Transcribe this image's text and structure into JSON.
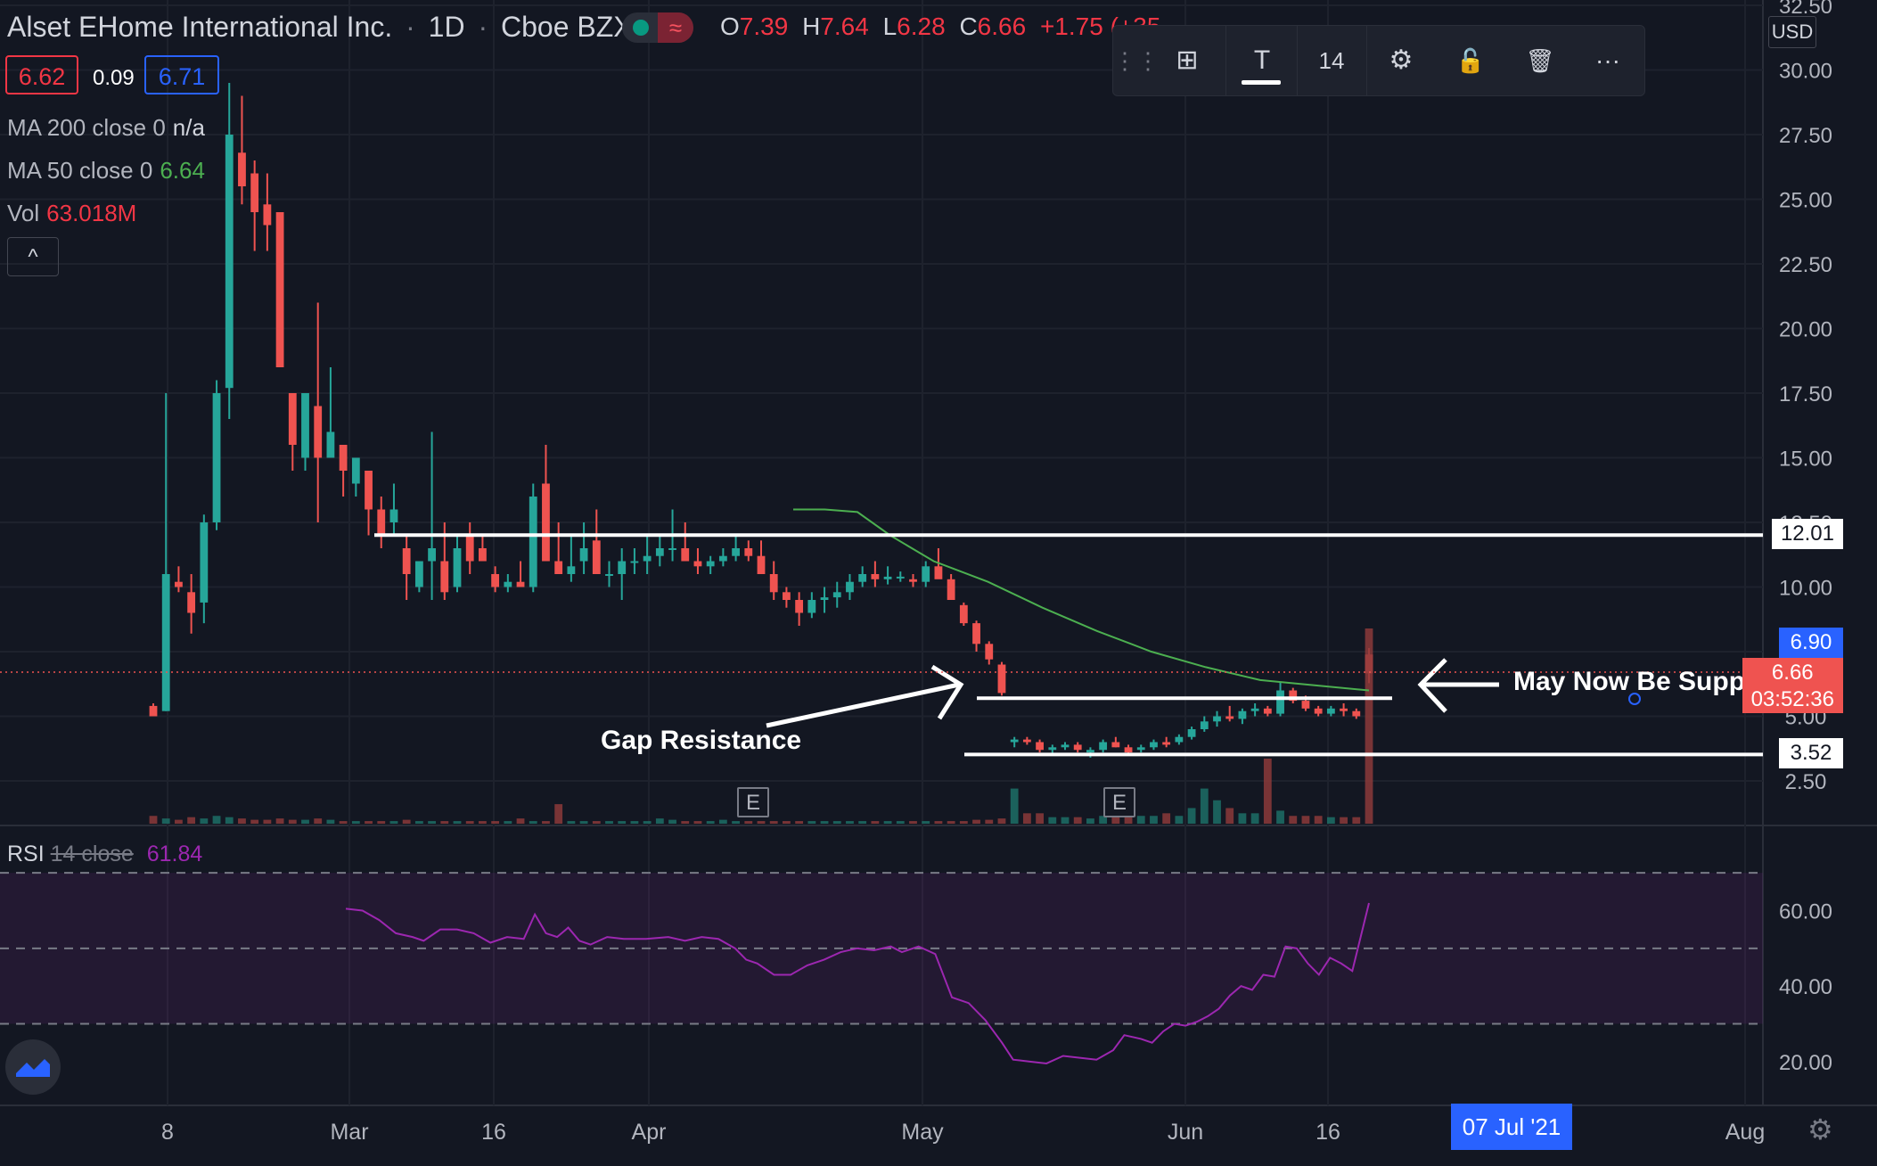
{
  "header": {
    "symbol_name": "Alset EHome International Inc.",
    "interval": "1D",
    "exchange": "Cboe BZX",
    "ohlc": [
      {
        "key": "O",
        "value": "7.39"
      },
      {
        "key": "H",
        "value": "7.64"
      },
      {
        "key": "L",
        "value": "6.28"
      },
      {
        "key": "C",
        "value": "6.66"
      }
    ],
    "change": "+1.75 (+35",
    "bid": "6.62",
    "spread": "0.09",
    "ask": "6.71",
    "toggle_icon": "≈"
  },
  "indicators": [
    {
      "name": "MA 200 close 0",
      "value": "n/a",
      "color": "#d1d4dc"
    },
    {
      "name": "MA 50 close 0",
      "value": "6.64",
      "color": "#4caf50"
    },
    {
      "name": "Vol",
      "value": "63.018M",
      "color": "#f23645"
    }
  ],
  "collapse_icon": "^",
  "toolbar": {
    "items": [
      {
        "icon": "drag-handle-icon",
        "label": "⋮⋮"
      },
      {
        "icon": "object-tree-icon",
        "label": "⊞"
      },
      {
        "icon": "text-icon",
        "label": "T"
      },
      {
        "icon": "font-size",
        "label": "14"
      },
      {
        "icon": "settings-icon",
        "label": "⚙"
      },
      {
        "icon": "lock-icon",
        "label": "🔓"
      },
      {
        "icon": "trash-icon",
        "label": "🗑"
      },
      {
        "icon": "more-icon",
        "label": "···"
      }
    ]
  },
  "annotations": {
    "gap_resistance": "Gap Resistance",
    "may_now_be_support": "May Now Be Support"
  },
  "price_labels": {
    "currency": "USD",
    "level_high": "12.01",
    "level_low": "3.52",
    "bid_price": "6.90",
    "last_price": "6.66",
    "countdown": "03:52:36"
  },
  "earnings_marker": "E",
  "rsi": {
    "name": "RSI",
    "params": "14 close",
    "value": "61.84"
  },
  "date_flag": "07 Jul '21",
  "colors": {
    "up": "#26a69a",
    "down": "#ef5350",
    "ma50": "#4caf50",
    "rsi": "#9c27b0",
    "accent": "#2962ff"
  },
  "chart_data": {
    "type": "candlestick",
    "price_axis": {
      "ticks": [
        "2.50",
        "5.00",
        "7.50",
        "10.00",
        "12.50",
        "15.00",
        "17.50",
        "20.00",
        "22.50",
        "25.00",
        "27.50",
        "30.00",
        "32.50"
      ],
      "ylim": [
        1.6,
        33.0
      ]
    },
    "x_ticks": [
      "8",
      "Mar",
      "16",
      "Apr",
      "May",
      "Jun",
      "16",
      "Aug"
    ],
    "horizontal_levels": [
      12.01,
      5.7,
      3.52
    ],
    "candles": [
      [
        5.4,
        5.5,
        5.1,
        5.0
      ],
      [
        5.2,
        17.5,
        5.2,
        10.5
      ],
      [
        10.2,
        10.8,
        9.8,
        10.0
      ],
      [
        9.8,
        10.5,
        8.2,
        9.0
      ],
      [
        9.4,
        12.8,
        8.6,
        12.5
      ],
      [
        12.5,
        18.0,
        12.2,
        17.5
      ],
      [
        17.7,
        29.5,
        16.5,
        27.5
      ],
      [
        26.8,
        29.0,
        24.8,
        25.5
      ],
      [
        26.0,
        26.5,
        23.0,
        24.5
      ],
      [
        24.8,
        26.0,
        23.0,
        24.0
      ],
      [
        24.5,
        23.5,
        21.0,
        18.5
      ],
      [
        17.5,
        16.5,
        14.5,
        15.5
      ],
      [
        15.0,
        17.5,
        14.5,
        17.5
      ],
      [
        17.0,
        21.0,
        12.5,
        15.0
      ],
      [
        15.0,
        18.5,
        15.0,
        16.0
      ],
      [
        15.5,
        15.5,
        13.5,
        14.5
      ],
      [
        14.0,
        15.0,
        13.5,
        15.0
      ],
      [
        14.5,
        14.5,
        12.0,
        13.0
      ],
      [
        13.0,
        13.5,
        11.5,
        12.0
      ],
      [
        12.5,
        14.0,
        12.0,
        13.0
      ],
      [
        11.5,
        12.0,
        9.5,
        10.5
      ],
      [
        10.0,
        11.0,
        9.8,
        11.0
      ],
      [
        11.0,
        16.0,
        9.5,
        11.5
      ],
      [
        11.0,
        12.5,
        9.5,
        9.8
      ],
      [
        10.0,
        12.0,
        9.8,
        11.5
      ],
      [
        12.0,
        12.5,
        10.5,
        11.0
      ],
      [
        11.5,
        12.0,
        11.0,
        11.0
      ],
      [
        10.5,
        10.8,
        9.8,
        10.0
      ],
      [
        10.0,
        10.5,
        9.8,
        10.2
      ],
      [
        10.2,
        11.0,
        10.0,
        10.0
      ],
      [
        10.0,
        14.0,
        9.8,
        13.5
      ],
      [
        14.0,
        15.5,
        12.0,
        11.0
      ],
      [
        11.0,
        12.5,
        10.5,
        10.5
      ],
      [
        10.5,
        12.0,
        10.2,
        10.8
      ],
      [
        11.0,
        12.5,
        10.5,
        11.5
      ],
      [
        11.8,
        13.0,
        10.5,
        10.5
      ],
      [
        10.5,
        11.0,
        10.0,
        10.5
      ],
      [
        10.5,
        11.5,
        9.5,
        11.0
      ],
      [
        11.0,
        11.5,
        10.5,
        11.0
      ],
      [
        11.0,
        12.0,
        10.5,
        11.2
      ],
      [
        11.2,
        12.0,
        10.8,
        11.5
      ],
      [
        11.5,
        13.0,
        11.0,
        11.5
      ],
      [
        11.5,
        12.5,
        11.0,
        11.0
      ],
      [
        11.0,
        11.5,
        10.5,
        10.8
      ],
      [
        10.8,
        11.2,
        10.5,
        11.0
      ],
      [
        11.0,
        11.5,
        10.8,
        11.2
      ],
      [
        11.2,
        12.0,
        11.0,
        11.5
      ],
      [
        11.5,
        11.8,
        11.0,
        11.2
      ],
      [
        11.2,
        11.8,
        10.5,
        10.5
      ],
      [
        10.5,
        11.0,
        9.5,
        9.8
      ],
      [
        9.8,
        10.0,
        9.2,
        9.5
      ],
      [
        9.5,
        9.8,
        8.5,
        9.0
      ],
      [
        9.0,
        9.8,
        8.8,
        9.5
      ],
      [
        9.5,
        10.0,
        9.0,
        9.6
      ],
      [
        9.6,
        10.2,
        9.2,
        9.8
      ],
      [
        9.8,
        10.5,
        9.5,
        10.2
      ],
      [
        10.2,
        10.8,
        10.0,
        10.5
      ],
      [
        10.5,
        11.0,
        10.0,
        10.3
      ],
      [
        10.3,
        10.8,
        10.1,
        10.4
      ],
      [
        10.4,
        10.6,
        10.2,
        10.4
      ],
      [
        10.3,
        10.5,
        10.0,
        10.2
      ],
      [
        10.2,
        11.0,
        10.0,
        10.8
      ],
      [
        10.8,
        11.5,
        10.5,
        10.3
      ],
      [
        10.3,
        10.5,
        9.5,
        9.5
      ],
      [
        9.3,
        9.4,
        8.5,
        8.6
      ],
      [
        8.6,
        8.7,
        7.5,
        7.8
      ],
      [
        7.8,
        7.9,
        7.0,
        7.2
      ],
      [
        7.0,
        7.1,
        5.8,
        5.9
      ],
      [
        4.0,
        4.2,
        3.8,
        4.1
      ],
      [
        4.1,
        4.2,
        3.9,
        4.0
      ],
      [
        4.0,
        4.1,
        3.6,
        3.7
      ],
      [
        3.7,
        3.9,
        3.5,
        3.8
      ],
      [
        3.8,
        4.0,
        3.7,
        3.9
      ],
      [
        3.9,
        4.0,
        3.6,
        3.7
      ],
      [
        3.6,
        3.8,
        3.4,
        3.7
      ],
      [
        3.7,
        4.1,
        3.6,
        4.0
      ],
      [
        4.0,
        4.2,
        3.8,
        3.8
      ],
      [
        3.8,
        3.9,
        3.5,
        3.6
      ],
      [
        3.7,
        3.9,
        3.6,
        3.8
      ],
      [
        3.8,
        4.1,
        3.7,
        4.0
      ],
      [
        4.0,
        4.2,
        3.8,
        3.9
      ],
      [
        4.0,
        4.3,
        3.9,
        4.2
      ],
      [
        4.2,
        4.6,
        4.1,
        4.5
      ],
      [
        4.5,
        5.0,
        4.4,
        4.8
      ],
      [
        4.8,
        5.2,
        4.6,
        5.0
      ],
      [
        5.0,
        5.4,
        4.8,
        4.9
      ],
      [
        4.9,
        5.3,
        4.7,
        5.2
      ],
      [
        5.2,
        5.5,
        5.0,
        5.3
      ],
      [
        5.3,
        5.4,
        5.0,
        5.1
      ],
      [
        5.1,
        6.3,
        5.0,
        6.0
      ],
      [
        6.0,
        6.1,
        5.5,
        5.6
      ],
      [
        5.6,
        5.8,
        5.2,
        5.3
      ],
      [
        5.3,
        5.4,
        5.0,
        5.1
      ],
      [
        5.1,
        5.4,
        5.0,
        5.3
      ],
      [
        5.3,
        5.5,
        5.0,
        5.2
      ],
      [
        5.2,
        5.3,
        4.9,
        5.0
      ],
      [
        7.39,
        7.64,
        6.28,
        6.66
      ]
    ],
    "volume": [
      0.6,
      0.4,
      0.3,
      0.5,
      0.4,
      0.6,
      0.5,
      0.4,
      0.3,
      0.3,
      0.4,
      0.3,
      0.3,
      0.4,
      0.3,
      0.2,
      0.2,
      0.2,
      0.2,
      0.2,
      0.3,
      0.2,
      0.2,
      0.2,
      0.2,
      0.2,
      0.2,
      0.2,
      0.2,
      0.4,
      0.2,
      0.2,
      1.5,
      0.2,
      0.2,
      0.2,
      0.2,
      0.2,
      0.2,
      0.2,
      0.4,
      0.3,
      0.2,
      0.2,
      0.2,
      0.3,
      0.2,
      0.2,
      0.2,
      0.2,
      0.2,
      0.2,
      0.2,
      0.2,
      0.2,
      0.2,
      0.2,
      0.2,
      0.2,
      0.2,
      0.2,
      0.2,
      0.2,
      0.2,
      0.2,
      0.3,
      0.3,
      0.4,
      2.7,
      0.8,
      0.8,
      0.5,
      0.5,
      0.5,
      0.4,
      0.6,
      1.0,
      0.6,
      0.6,
      0.6,
      0.8,
      0.6,
      1.2,
      2.7,
      1.8,
      1.2,
      0.8,
      0.8,
      5.0,
      1.0,
      0.6,
      0.6,
      0.6,
      0.5,
      0.5,
      0.5,
      15.0
    ],
    "ma50": [
      [
        0.471,
        13.0
      ],
      [
        0.5,
        13.0
      ],
      [
        0.53,
        12.9
      ],
      [
        0.56,
        12.0
      ],
      [
        0.6,
        11.0
      ],
      [
        0.65,
        10.2
      ],
      [
        0.7,
        9.2
      ],
      [
        0.75,
        8.3
      ],
      [
        0.8,
        7.5
      ],
      [
        0.85,
        6.9
      ],
      [
        0.9,
        6.4
      ],
      [
        0.95,
        6.2
      ],
      [
        1.0,
        6.0
      ]
    ],
    "rsi": {
      "ylim": [
        15,
        75
      ],
      "ticks": [
        "20.00",
        "40.00",
        "60.00"
      ],
      "bands": [
        30,
        50,
        70
      ],
      "values": [
        [
          0.2,
          60.5
        ],
        [
          0.215,
          60.0
        ],
        [
          0.23,
          57.5
        ],
        [
          0.245,
          54.0
        ],
        [
          0.26,
          53.0
        ],
        [
          0.27,
          52.0
        ],
        [
          0.285,
          55.0
        ],
        [
          0.3,
          55.0
        ],
        [
          0.315,
          54.0
        ],
        [
          0.33,
          51.5
        ],
        [
          0.345,
          53.0
        ],
        [
          0.36,
          52.5
        ],
        [
          0.37,
          59.0
        ],
        [
          0.38,
          54.0
        ],
        [
          0.39,
          53.0
        ],
        [
          0.4,
          55.5
        ],
        [
          0.41,
          52.0
        ],
        [
          0.42,
          51.0
        ],
        [
          0.435,
          53.0
        ],
        [
          0.45,
          52.5
        ],
        [
          0.47,
          52.5
        ],
        [
          0.49,
          53.0
        ],
        [
          0.505,
          52.0
        ],
        [
          0.52,
          53.0
        ],
        [
          0.535,
          52.5
        ],
        [
          0.55,
          50.0
        ],
        [
          0.56,
          47.0
        ],
        [
          0.57,
          46.0
        ],
        [
          0.585,
          43.0
        ],
        [
          0.6,
          43.0
        ],
        [
          0.615,
          45.5
        ],
        [
          0.63,
          47.0
        ],
        [
          0.645,
          49.0
        ],
        [
          0.66,
          50.0
        ],
        [
          0.675,
          49.5
        ],
        [
          0.69,
          50.5
        ],
        [
          0.7,
          49.0
        ],
        [
          0.715,
          50.5
        ],
        [
          0.73,
          48.5
        ],
        [
          0.745,
          37.0
        ],
        [
          0.76,
          35.5
        ],
        [
          0.775,
          31.0
        ],
        [
          0.79,
          25.0
        ],
        [
          0.8,
          20.5
        ],
        [
          0.815,
          20.0
        ],
        [
          0.83,
          19.5
        ],
        [
          0.845,
          21.5
        ],
        [
          0.86,
          21.0
        ],
        [
          0.875,
          20.5
        ],
        [
          0.89,
          23.0
        ],
        [
          0.9,
          27.0
        ],
        [
          0.915,
          26.0
        ],
        [
          0.925,
          25.0
        ],
        [
          0.935,
          28.0
        ],
        [
          0.945,
          30.0
        ],
        [
          0.955,
          29.5
        ],
        [
          0.965,
          30.5
        ],
        [
          0.975,
          32.0
        ],
        [
          0.985,
          34.0
        ],
        [
          0.995,
          37.5
        ],
        [
          1.005,
          40.0
        ],
        [
          1.015,
          39.0
        ],
        [
          1.025,
          43.0
        ],
        [
          1.035,
          42.5
        ],
        [
          1.045,
          50.5
        ],
        [
          1.055,
          50.0
        ],
        [
          1.065,
          46.0
        ],
        [
          1.075,
          43.0
        ],
        [
          1.085,
          47.5
        ],
        [
          1.095,
          46.0
        ],
        [
          1.105,
          44.0
        ],
        [
          1.12,
          62.0
        ]
      ]
    }
  }
}
